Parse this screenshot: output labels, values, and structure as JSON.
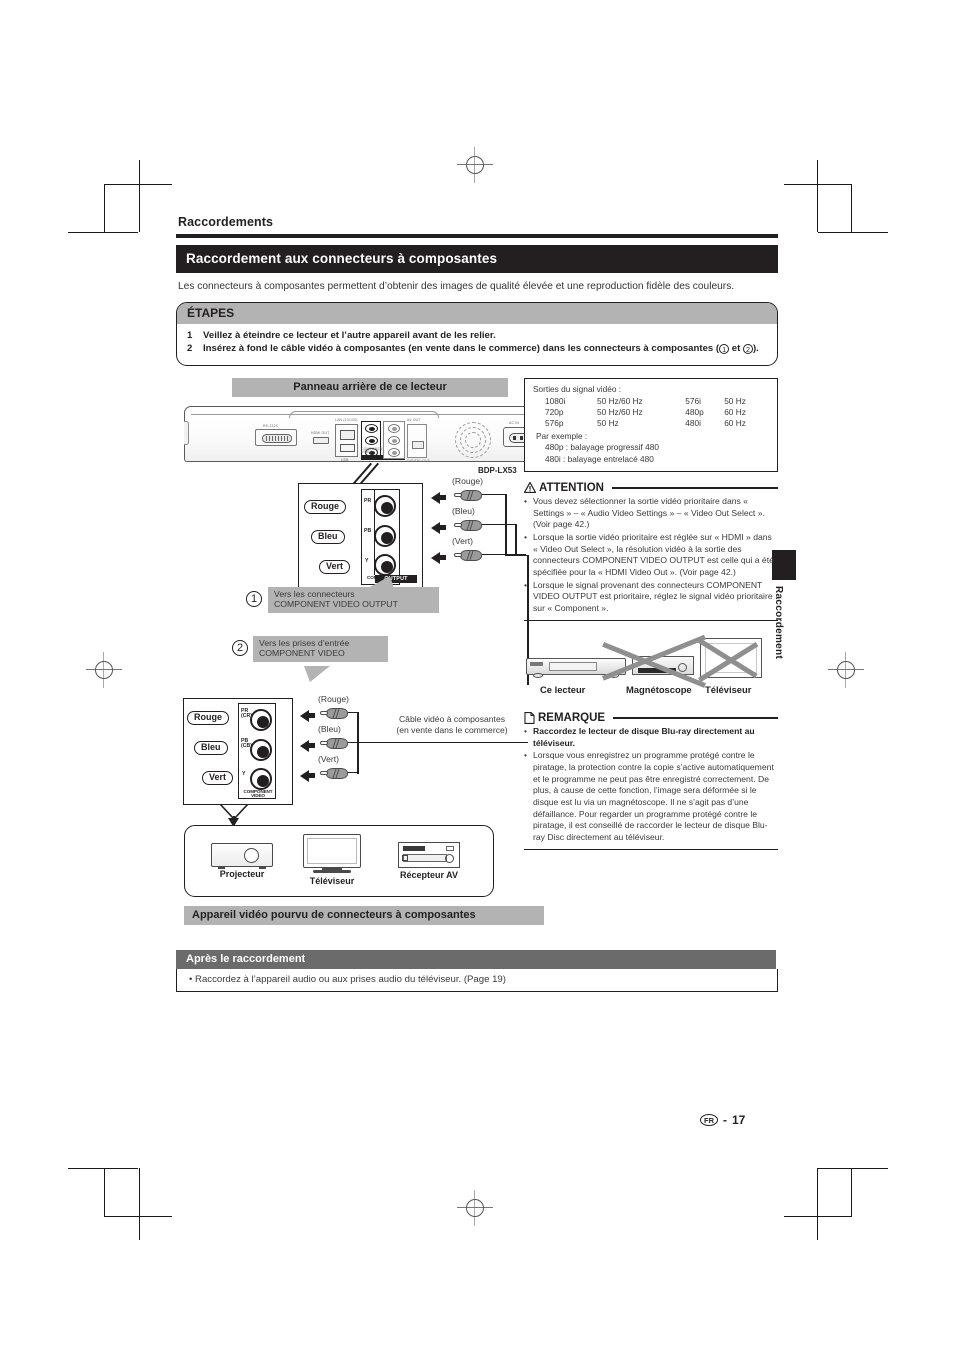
{
  "page": {
    "running_head": "Raccordements",
    "section_title": "Raccordement aux connecteurs à composantes",
    "intro": "Les connecteurs à composantes permettent d’obtenir des images de qualité élevée et une reproduction fidèle des couleurs.",
    "folio_locale": "FR",
    "folio_sep": "-",
    "folio_number": "17",
    "side_tab_label": "Raccordement"
  },
  "steps": {
    "heading": "ÉTAPES",
    "items": [
      {
        "num": "1",
        "text": "Veillez à éteindre ce lecteur et l’autre appareil avant de les relier."
      },
      {
        "num": "2",
        "text_before": "Insérez à fond le câble vidéo à composantes (en vente dans le commerce) dans les connecteurs à composantes (",
        "circle_1": "1",
        "text_mid": " et ",
        "circle_2": "2",
        "text_after": ")."
      }
    ]
  },
  "diagram": {
    "top_banner": "Panneau arrière de ce lecteur",
    "bottom_banner": "Appareil vidéo pourvu de connecteurs à composantes",
    "model_label": "BDP-LX53",
    "rear_panel_tiny_labels": {
      "rs232": "RS-232C",
      "hdmi": "HDMI OUT",
      "lan": "LAN (10/100)",
      "usb": "USB",
      "component": "COMPONENT VIDEO",
      "output": "OUTPUT",
      "av": "AV OUT",
      "digital": "DIGITAL OUT",
      "acin": "AC IN"
    },
    "jack_box_player": {
      "pills": [
        "Rouge",
        "Bleu",
        "Vert"
      ],
      "jack_labels": [
        "PR",
        "PB",
        "Y"
      ],
      "panel_text_line1": "COMPONENT",
      "panel_text_line2": "VIDEO",
      "output_badge": "OUTPUT"
    },
    "jack_box_device": {
      "pills": [
        "Rouge",
        "Bleu",
        "Vert"
      ],
      "jack_labels": [
        "PR",
        "PB",
        "Y"
      ],
      "jack_sublabels": [
        "(CR)",
        "(CB)",
        ""
      ],
      "panel_text_line1": "COMPONENT",
      "panel_text_line2": "VIDEO"
    },
    "plug_labels_top": [
      "(Rouge)",
      "(Bleu)",
      "(Vert)"
    ],
    "plug_labels_bottom": [
      "(Rouge)",
      "(Bleu)",
      "(Vert)"
    ],
    "callout_1": {
      "num": "1",
      "line1": "Vers les connecteurs",
      "line2": "COMPONENT VIDEO OUTPUT"
    },
    "callout_2": {
      "num": "2",
      "line1": "Vers les prises d’entrée",
      "line2": "COMPONENT VIDEO"
    },
    "cable_note": {
      "line1": "Câble vidéo à composantes",
      "line2": "(en vente dans le commerce)"
    },
    "devices": [
      {
        "caption": "Projecteur"
      },
      {
        "caption": "Téléviseur"
      },
      {
        "caption": "Récepteur AV"
      }
    ]
  },
  "signal_box": {
    "heading": "Sorties du signal vidéo :",
    "rows": [
      {
        "a": "1080i",
        "b": "50 Hz/60 Hz",
        "c": "576i",
        "d": "50 Hz"
      },
      {
        "a": "720p",
        "b": "50 Hz/60 Hz",
        "c": "480p",
        "d": "60 Hz"
      },
      {
        "a": "576p",
        "b": "50 Hz",
        "c": "480i",
        "d": "60 Hz"
      }
    ],
    "example_heading": "Par exemple :",
    "examples": [
      "480p : balayage progressif 480",
      "480i :  balayage entrelacé 480"
    ]
  },
  "attention": {
    "title": "ATTENTION",
    "icon": "warning-triangle-icon",
    "bullets": [
      "Vous devez sélectionner la sortie vidéo prioritaire dans « Settings » – « Audio Video Settings » – « Video Out Select ». (Voir page 42.)",
      "Lorsque la sortie vidéo prioritaire est réglée sur « HDMI » dans « Video Out Select », la résolution vidéo à la sortie des connecteurs COMPONENT VIDEO OUTPUT est celle qui a été spécifiée pour la « HDMI Video Out ». (Voir page 42.)",
      "Lorsque le signal provenant des connecteurs COMPONENT VIDEO OUTPUT est prioritaire, réglez le signal vidéo prioritaire sur « Component »."
    ]
  },
  "bad_connection": {
    "captions": [
      "Ce lecteur",
      "Magnétoscope",
      "Téléviseur"
    ]
  },
  "remark": {
    "title": "REMARQUE",
    "icon": "note-document-icon",
    "bullets": [
      {
        "bold": true,
        "text": "Raccordez le lecteur de disque Blu-ray directement au téléviseur."
      },
      {
        "bold": false,
        "text": "Lorsque vous enregistrez un programme protégé contre le piratage, la protection contre la copie s’active automatiquement et le programme ne peut pas être enregistré correctement. De plus, à cause de cette fonction, l’image sera déformée si le disque est lu via un magnétoscope. Il ne s’agit pas d’une défaillance. Pour regarder un programme protégé contre le piratage, il est conseillé de raccorder le lecteur de disque Blu-ray Disc directement au téléviseur."
      }
    ]
  },
  "after": {
    "heading": "Après le raccordement",
    "bullet": "• Raccordez à l’appareil audio ou aux prises audio du téléviseur. (Page 19)"
  },
  "colors": {
    "black": "#231f20",
    "banner_grey": "#b3b3b3",
    "after_grey": "#6b6b6b",
    "plug_grey": "#9b9b9b"
  }
}
